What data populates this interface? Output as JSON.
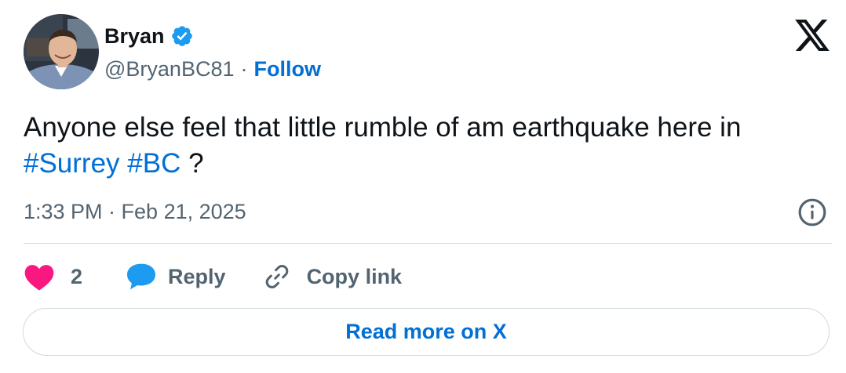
{
  "author": {
    "name": "Bryan",
    "handle": "@BryanBC81",
    "separator": "·",
    "follow_label": "Follow",
    "verified_icon": "verified-badge-icon",
    "avatar_icon": "profile-photo"
  },
  "brand": {
    "logo_icon": "x-logo-icon"
  },
  "tweet": {
    "text_main": "Anyone else feel that little rumble of am earthquake here in",
    "hashtags": [
      "#Surrey",
      "#BC"
    ],
    "text_end": "?"
  },
  "meta": {
    "timestamp": "1:33 PM · Feb 21, 2025",
    "info_icon": "info-icon"
  },
  "actions": {
    "like_count": "2",
    "like_icon": "heart-icon",
    "reply_label": "Reply",
    "reply_icon": "speech-bubble-icon",
    "copy_label": "Copy link",
    "copy_icon": "link-icon"
  },
  "cta": {
    "read_more_label": "Read more on X"
  },
  "colors": {
    "text": "#0f1419",
    "secondary": "#536471",
    "link": "#006fd6",
    "like": "#f91880",
    "reply": "#1d9bf0",
    "verified": "#1d9bf0",
    "border": "#cfd9de"
  }
}
